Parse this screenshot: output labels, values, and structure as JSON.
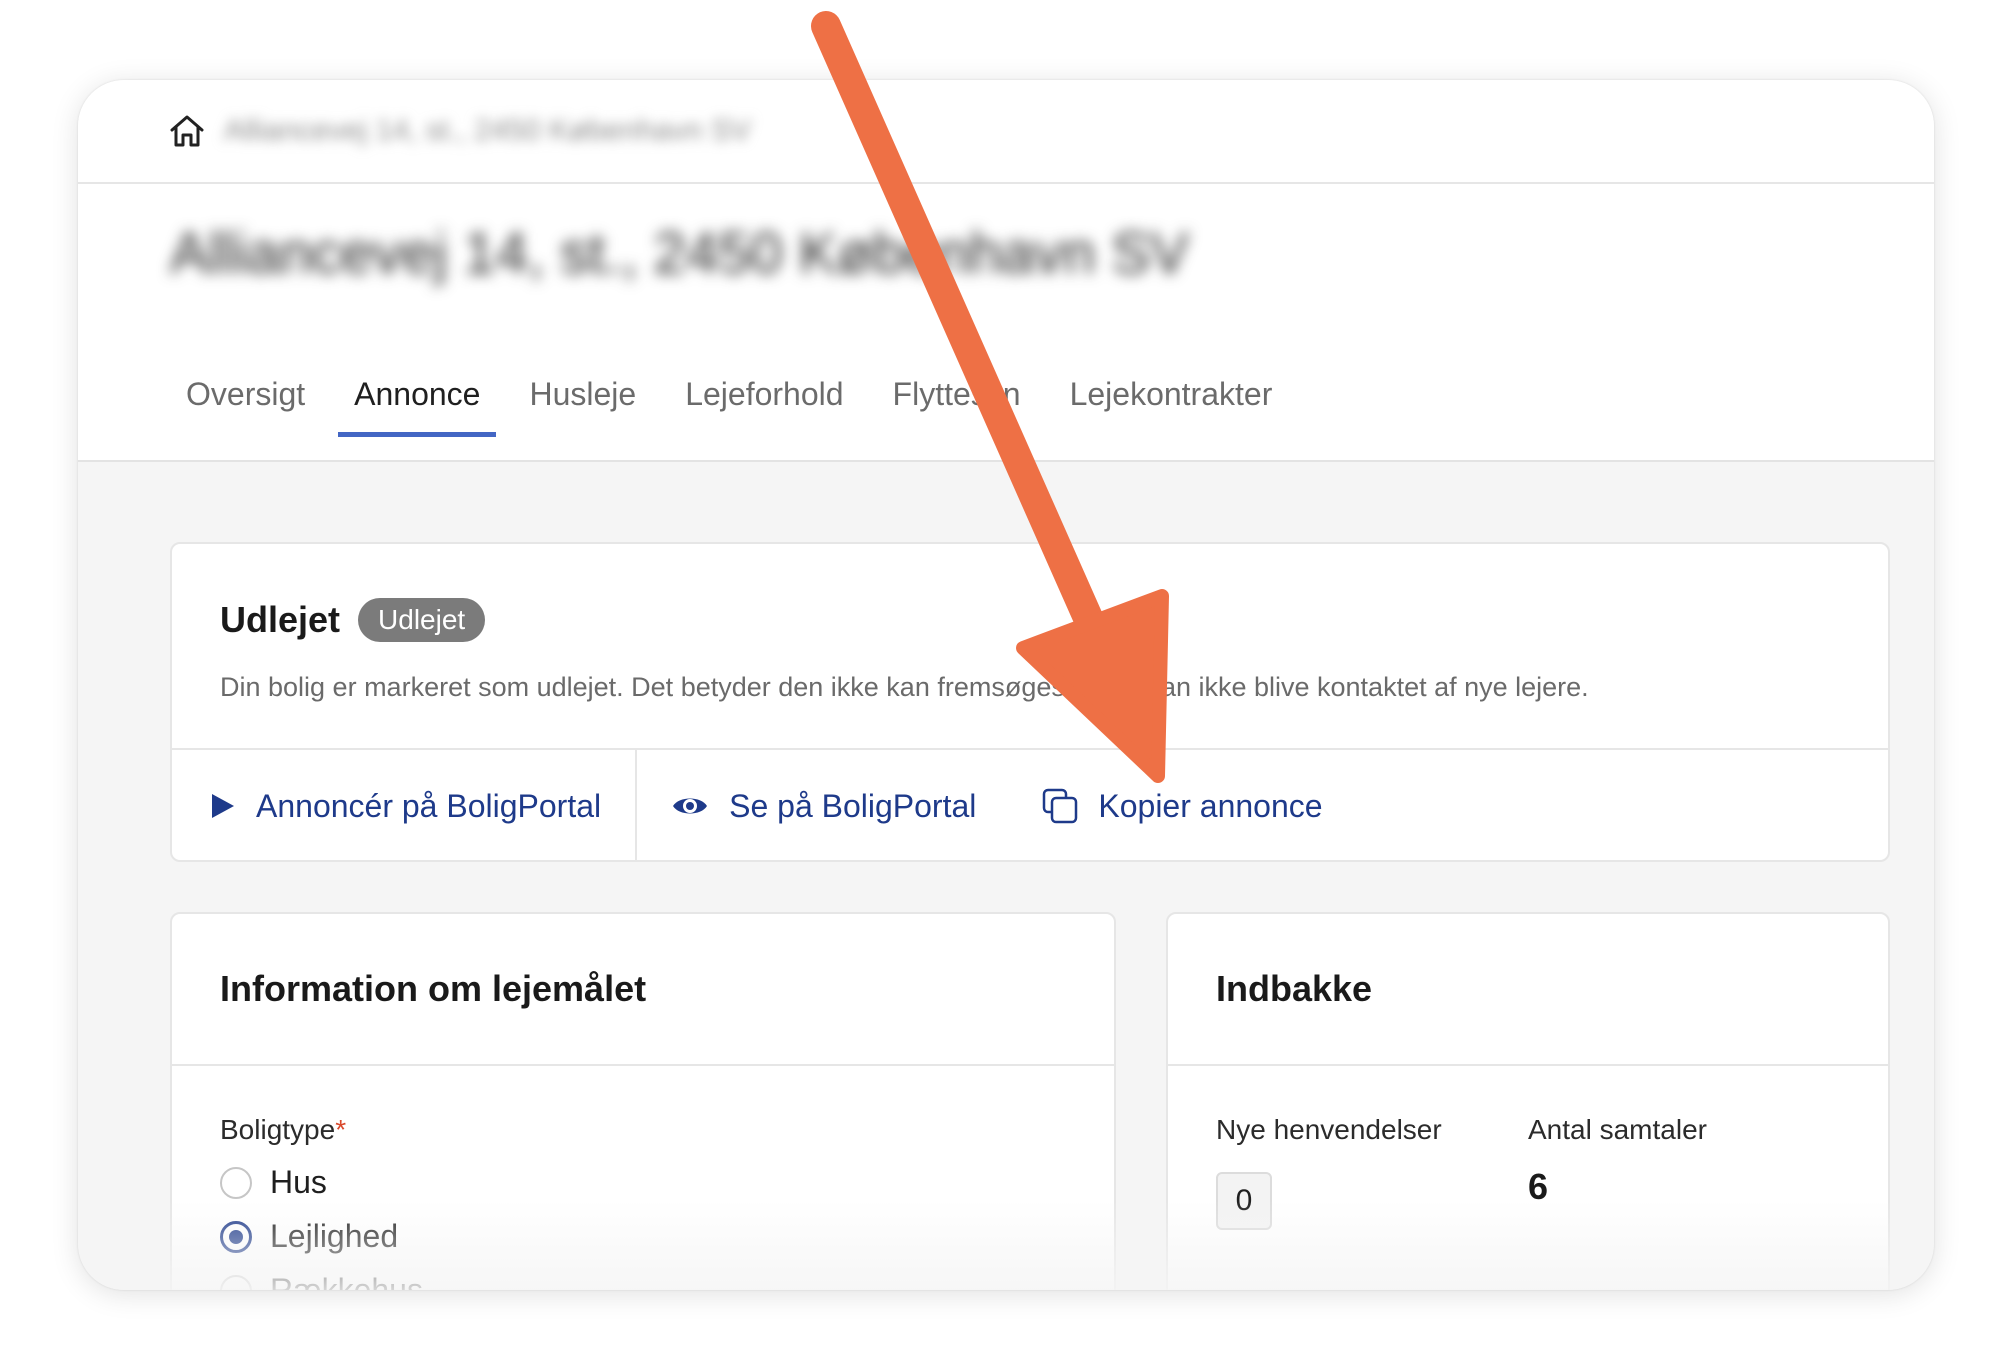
{
  "breadcrumb": {
    "home_icon": "home-icon",
    "address": "Alliancevej 14, st., 2450 København SV"
  },
  "page_title": "Alliancevej 14, st., 2450 København SV",
  "tabs": [
    {
      "label": "Oversigt",
      "active": false
    },
    {
      "label": "Annonce",
      "active": true
    },
    {
      "label": "Husleje",
      "active": false
    },
    {
      "label": "Lejeforhold",
      "active": false
    },
    {
      "label": "Flyttesyn",
      "active": false
    },
    {
      "label": "Lejekontrakter",
      "active": false
    }
  ],
  "status": {
    "title": "Udlejet",
    "badge": "Udlejet",
    "description": "Din bolig er markeret som udlejet. Det betyder den ikke kan fremsøges og du kan ikke blive kontaktet af nye lejere.",
    "actions": {
      "advertise": {
        "label": "Annoncér på BoligPortal",
        "icon": "play-icon"
      },
      "view": {
        "label": "Se på BoligPortal",
        "icon": "eye-icon"
      },
      "copy": {
        "label": "Kopier annonce",
        "icon": "copy-icon"
      }
    }
  },
  "info": {
    "title": "Information om lejemålet",
    "field_label": "Boligtype",
    "required_mark": "*",
    "options": [
      {
        "label": "Hus",
        "checked": false
      },
      {
        "label": "Lejlighed",
        "checked": true
      },
      {
        "label": "Rækkehus",
        "checked": false
      }
    ]
  },
  "inbox": {
    "title": "Indbakke",
    "new_label": "Nye henvendelser",
    "new_value": "0",
    "conversations_label": "Antal samtaler",
    "conversations_value": "6"
  },
  "colors": {
    "accent": "#1e3a8a",
    "tab_underline": "#4366c4",
    "badge": "#7b7b7b",
    "arrow": "#ee7045"
  }
}
